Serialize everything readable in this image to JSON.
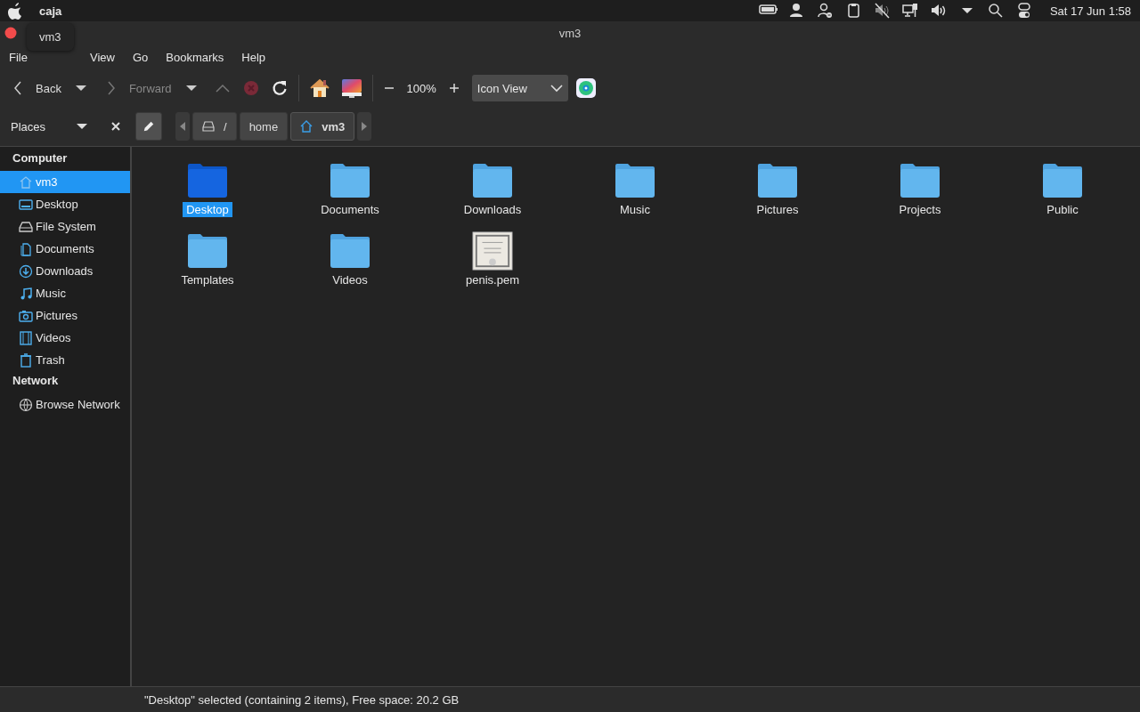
{
  "top_panel": {
    "app_name": "caja",
    "clock": "Sat 17 Jun 1:58"
  },
  "tooltip": "vm3",
  "window": {
    "title": "vm3"
  },
  "menu": [
    "File",
    "View",
    "Go",
    "Bookmarks",
    "Help"
  ],
  "toolbar": {
    "back": {
      "label": "Back",
      "disabled": false
    },
    "forward": {
      "label": "Forward",
      "disabled": true
    },
    "up_disabled": true,
    "stop_disabled": true,
    "zoom": "100%",
    "view_mode": "Icon View"
  },
  "location": {
    "sidebar_title": "Places",
    "path": [
      {
        "label": "/",
        "kind": "drive",
        "selected": false
      },
      {
        "label": "home",
        "kind": "plain",
        "selected": false
      },
      {
        "label": "vm3",
        "kind": "home",
        "selected": true
      }
    ]
  },
  "sidebar": [
    {
      "heading": "Computer",
      "items": [
        {
          "label": "vm3",
          "selected": true
        },
        {
          "label": "Desktop",
          "selected": false
        },
        {
          "label": "File System",
          "selected": false
        },
        {
          "label": "Documents",
          "selected": false
        },
        {
          "label": "Downloads",
          "selected": false
        },
        {
          "label": "Music",
          "selected": false
        },
        {
          "label": "Pictures",
          "selected": false
        },
        {
          "label": "Videos",
          "selected": false
        },
        {
          "label": "Trash",
          "selected": false
        }
      ]
    },
    {
      "heading": "Network",
      "items": [
        {
          "label": "Browse Network",
          "selected": false
        }
      ]
    }
  ],
  "files": [
    {
      "name": "Desktop",
      "kind": "folder",
      "selected": true
    },
    {
      "name": "Documents",
      "kind": "folder",
      "selected": false
    },
    {
      "name": "Downloads",
      "kind": "folder",
      "selected": false
    },
    {
      "name": "Music",
      "kind": "folder",
      "selected": false
    },
    {
      "name": "Pictures",
      "kind": "folder",
      "selected": false
    },
    {
      "name": "Projects",
      "kind": "folder",
      "selected": false
    },
    {
      "name": "Public",
      "kind": "folder",
      "selected": false
    },
    {
      "name": "Templates",
      "kind": "folder",
      "selected": false
    },
    {
      "name": "Videos",
      "kind": "folder",
      "selected": false
    },
    {
      "name": "penis.pem",
      "kind": "certificate",
      "selected": false
    }
  ],
  "status_bar": "\"Desktop\" selected (containing 2 items), Free space: 20.2 GB"
}
